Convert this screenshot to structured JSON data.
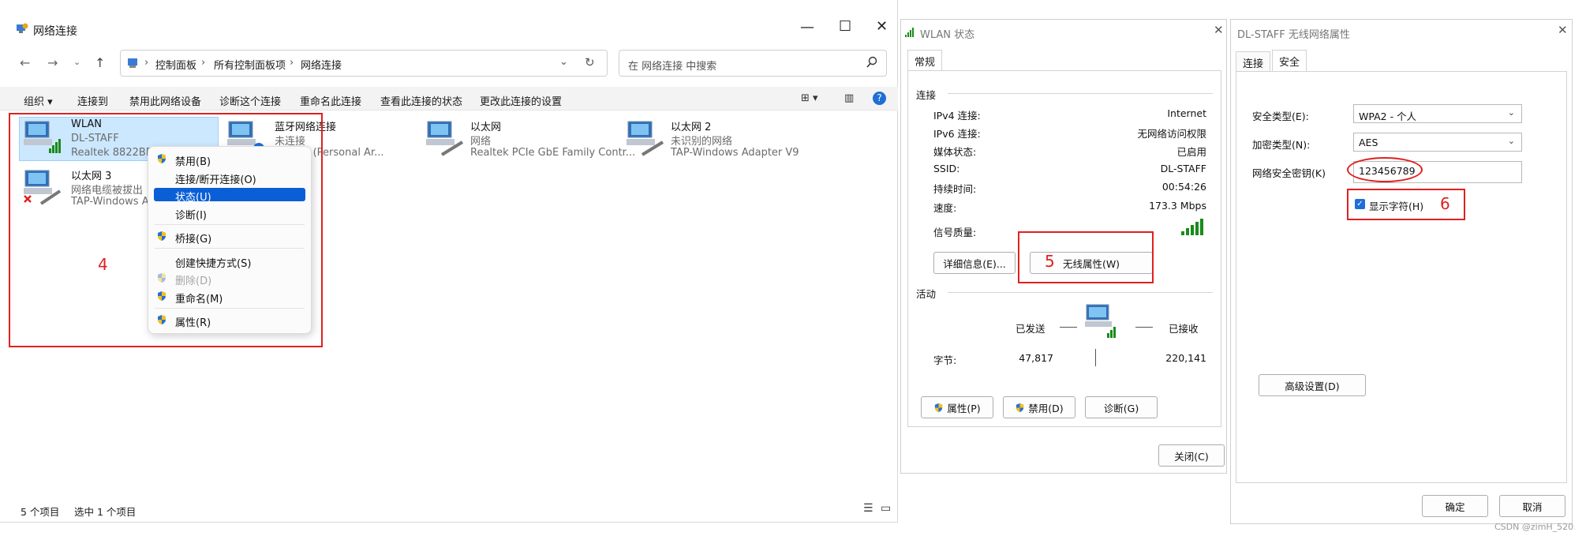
{
  "explorer": {
    "title": "网络连接",
    "breadcrumb": [
      "控制面板",
      "所有控制面板项",
      "网络连接"
    ],
    "search_placeholder": "在 网络连接 中搜索",
    "commands": [
      "组织 ▾",
      "连接到",
      "禁用此网络设备",
      "诊断这个连接",
      "重命名此连接",
      "查看此连接的状态",
      "更改此连接的设置"
    ],
    "items": [
      {
        "name": "WLAN",
        "line2": "DL-STAFF",
        "line3": "Realtek 8822BE W"
      },
      {
        "name": "蓝牙网络连接",
        "line2": "未连接",
        "line3": "Device (Personal Ar..."
      },
      {
        "name": "以太网",
        "line2": "网络",
        "line3": "Realtek PCIe GbE Family Contr..."
      },
      {
        "name": "以太网 2",
        "line2": "未识别的网络",
        "line3": "TAP-Windows Adapter V9"
      },
      {
        "name": "以太网 3",
        "line2": "网络电缆被拔出",
        "line3": "TAP-Windows Ada"
      }
    ],
    "context_menu": {
      "disable": "禁用(B)",
      "connect": "连接/断开连接(O)",
      "status": "状态(U)",
      "diagnose": "诊断(I)",
      "bridge": "桥接(G)",
      "shortcut": "创建快捷方式(S)",
      "delete": "删除(D)",
      "rename": "重命名(M)",
      "properties": "属性(R)"
    },
    "status_count": "5 个项目",
    "status_selected": "选中 1 个项目"
  },
  "annotations": {
    "n4": "4",
    "n5": "5",
    "n6": "6"
  },
  "wlan_status": {
    "title": "WLAN 状态",
    "tab": "常规",
    "section_connection": "连接",
    "rows": [
      {
        "label": "IPv4 连接:",
        "value": "Internet"
      },
      {
        "label": "IPv6 连接:",
        "value": "无网络访问权限"
      },
      {
        "label": "媒体状态:",
        "value": "已启用"
      },
      {
        "label": "SSID:",
        "value": "DL-STAFF"
      },
      {
        "label": "持续时间:",
        "value": "00:54:26"
      },
      {
        "label": "速度:",
        "value": "173.3 Mbps"
      }
    ],
    "signal_label": "信号质量:",
    "details_button": "详细信息(E)...",
    "wireless_props_button": "无线属性(W)",
    "section_activity": "活动",
    "sent_label": "已发送",
    "received_label": "已接收",
    "bytes_label": "字节:",
    "bytes_sent": "47,817",
    "bytes_received": "220,141",
    "properties_button": "属性(P)",
    "disable_button": "禁用(D)",
    "diagnose_button": "诊断(G)",
    "close_button": "关闭(C)"
  },
  "wireless_props": {
    "title": "DL-STAFF 无线网络属性",
    "tab_connection": "连接",
    "tab_security": "安全",
    "security_type_label": "安全类型(E):",
    "security_type_value": "WPA2 - 个人",
    "encryption_label": "加密类型(N):",
    "encryption_value": "AES",
    "key_label": "网络安全密钥(K)",
    "key_value": "123456789",
    "show_chars": "显示字符(H)",
    "advanced_button": "高级设置(D)",
    "ok_button": "确定",
    "cancel_button": "取消"
  },
  "watermark": "CSDN @zimH_520"
}
